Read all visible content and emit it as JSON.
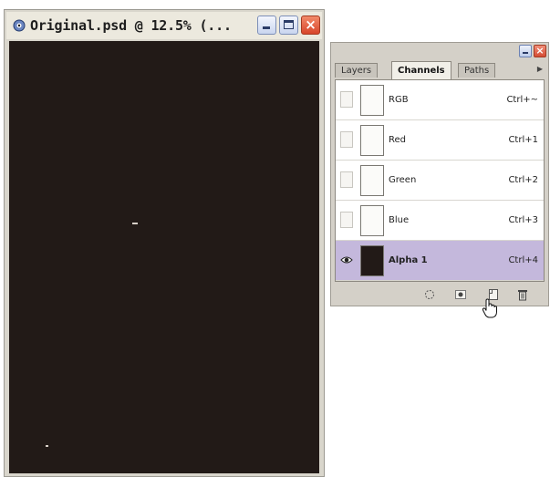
{
  "document_window": {
    "title": "Original.psd @ 12.5% (...",
    "icon": "photoshop-eye-icon",
    "canvas_color": "#221a17"
  },
  "channels_palette": {
    "tabs": [
      {
        "label": "Layers",
        "active": false
      },
      {
        "label": "Channels",
        "active": true
      },
      {
        "label": "Paths",
        "active": false
      }
    ],
    "channels": [
      {
        "name": "RGB",
        "shortcut": "Ctrl+~",
        "visible": false,
        "selected": false
      },
      {
        "name": "Red",
        "shortcut": "Ctrl+1",
        "visible": false,
        "selected": false
      },
      {
        "name": "Green",
        "shortcut": "Ctrl+2",
        "visible": false,
        "selected": false
      },
      {
        "name": "Blue",
        "shortcut": "Ctrl+3",
        "visible": false,
        "selected": false
      },
      {
        "name": "Alpha 1",
        "shortcut": "Ctrl+4",
        "visible": true,
        "selected": true
      }
    ],
    "footer_icons": [
      "load-selection-icon",
      "save-selection-icon",
      "new-channel-icon",
      "delete-channel-icon"
    ],
    "selected_color": "#c4b8dc"
  }
}
